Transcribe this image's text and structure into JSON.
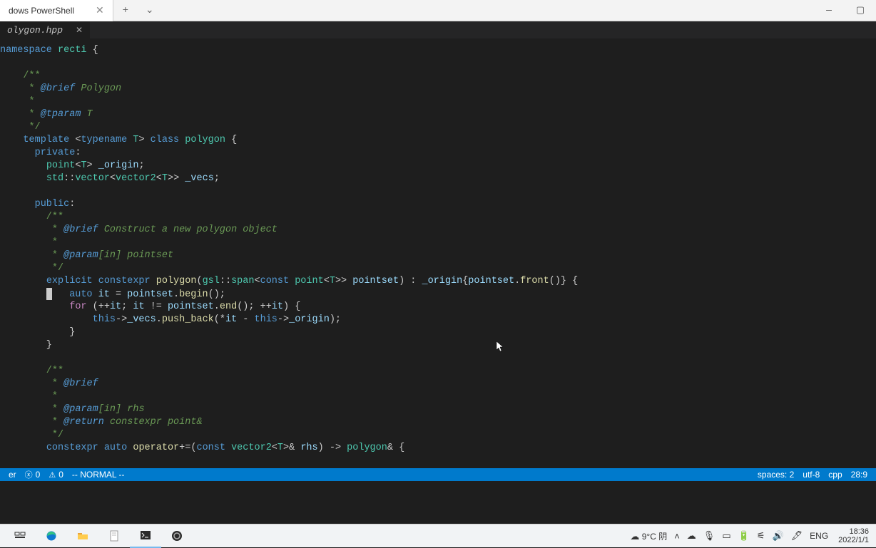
{
  "titlebar": {
    "tab_label": "dows PowerShell",
    "plus": "+",
    "drop": "⌄",
    "min": "—",
    "max": "▢"
  },
  "editor_tab": {
    "name": "olygon.hpp",
    "close": "✕"
  },
  "code": {
    "l1_kw": "namespace",
    "l1_id": "recti",
    "l1_op": " {",
    "l2": "",
    "l3": "    /**",
    "l4a": "     * ",
    "l4b": "@brief",
    "l4c": " Polygon",
    "l5": "     *",
    "l6a": "     * ",
    "l6b": "@tparam",
    "l6c": " T",
    "l7": "     */",
    "l8a": "    ",
    "l8kw": "template",
    "l8op1": " <",
    "l8kw2": "typename",
    "l8t": " T",
    "l8op2": "> ",
    "l8kw3": "class",
    "l8cl": " polygon",
    "l8op3": " {",
    "l9a": "      ",
    "l9kw": "private",
    "l9op": ":",
    "l10a": "        ",
    "l10t": "point",
    "l10op1": "<",
    "l10t2": "T",
    "l10op2": "> ",
    "l10v": "_origin",
    "l10op3": ";",
    "l11a": "        ",
    "l11n": "std",
    "l11op1": "::",
    "l11t": "vector",
    "l11op2": "<",
    "l11t2": "vector2",
    "l11op3": "<",
    "l11t3": "T",
    "l11op4": ">> ",
    "l11v": "_vecs",
    "l11op5": ";",
    "l12": "",
    "l13a": "      ",
    "l13kw": "public",
    "l13op": ":",
    "l14": "        /**",
    "l15a": "         * ",
    "l15b": "@brief",
    "l15c": " Construct a new polygon object",
    "l16": "         *",
    "l17a": "         * ",
    "l17b": "@param",
    "l17c": "[in]",
    "l17d": " pointset",
    "l18": "         */",
    "l19a": "        ",
    "l19kw": "explicit constexpr",
    "l19fn": " polygon",
    "l19op1": "(",
    "l19t": "gsl",
    "l19op2": "::",
    "l19t2": "span",
    "l19op3": "<",
    "l19kw2": "const",
    "l19t3": " point",
    "l19op4": "<",
    "l19t4": "T",
    "l19op5": ">> ",
    "l19v": "pointset",
    "l19op6": ") : ",
    "l19v2": "_origin",
    "l19op7": "{",
    "l19v3": "pointset",
    "l19op8": ".",
    "l19fn2": "front",
    "l19op9": "()} {",
    "l20a": "            ",
    "l20kw": "auto",
    "l20v": " it",
    "l20op": " = ",
    "l20v2": "pointset",
    "l20op2": ".",
    "l20fn": "begin",
    "l20op3": "();",
    "l21a": "            ",
    "l21kw": "for",
    "l21op": " (++",
    "l21v": "it",
    "l21op2": "; ",
    "l21v2": "it",
    "l21op3": " != ",
    "l21v3": "pointset",
    "l21op4": ".",
    "l21fn": "end",
    "l21op5": "(); ++",
    "l21v4": "it",
    "l21op6": ") {",
    "l22a": "                ",
    "l22kw": "this",
    "l22op": "->",
    "l22v": "_vecs",
    "l22op2": ".",
    "l22fn": "push_back",
    "l22op3": "(*",
    "l22v2": "it",
    "l22op4": " - ",
    "l22kw2": "this",
    "l22op5": "->",
    "l22v3": "_origin",
    "l22op6": ");",
    "l23": "            }",
    "l24": "        }",
    "l25": "",
    "l26": "        /**",
    "l27a": "         * ",
    "l27b": "@brief",
    "l28": "         *",
    "l29a": "         * ",
    "l29b": "@param",
    "l29c": "[in]",
    "l29d": " rhs",
    "l30a": "         * ",
    "l30b": "@return",
    "l30c": " constexpr point&",
    "l31": "         */",
    "l32a": "        ",
    "l32kw": "constexpr auto",
    "l32sp": " ",
    "l32fn": "operator",
    "l32op": "+=(",
    "l32kw2": "const",
    "l32t": " vector2",
    "l32op2": "<",
    "l32t2": "T",
    "l32op3": ">& ",
    "l32v": "rhs",
    "l32op4": ") -> ",
    "l32t3": "polygon",
    "l32op5": "& {"
  },
  "status": {
    "left1": "er",
    "err": "0",
    "warn": "0",
    "mode": "-- NORMAL --",
    "spaces": "spaces: 2",
    "enc": "utf-8",
    "lang": "cpp",
    "pos": "28:9"
  },
  "taskbar": {
    "weather": "9°C 阴",
    "ime": "ENG",
    "time": "18:36",
    "date": "2022/1/1"
  }
}
